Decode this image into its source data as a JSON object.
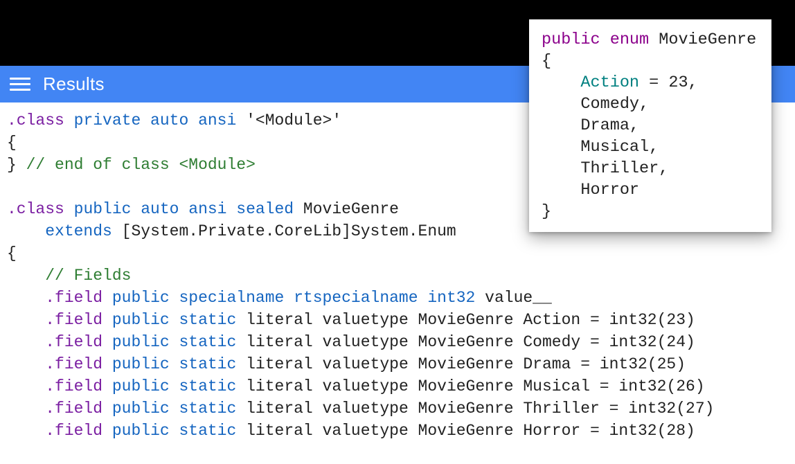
{
  "header": {
    "title": "Results"
  },
  "il": {
    "line1_dir": ".class",
    "line1_mods": "private auto ansi",
    "line1_name": "'<Module>'",
    "line2": "{",
    "line3_brace": "}",
    "line3_comment": "// end of class <Module>",
    "line5_dir": ".class",
    "line5_mods": "public auto ansi sealed",
    "line5_name": "MovieGenre",
    "line6_extends": "extends",
    "line6_target": "[System.Private.CoreLib]System.Enum",
    "line7": "{",
    "fields_comment": "// Fields",
    "f0_dir": ".field",
    "f0_mods": "public specialname rtspecialname",
    "f0_type": "int32",
    "f0_name": "value__",
    "f1_dir": ".field",
    "f1_mods": "public static",
    "f1_rest": "literal valuetype MovieGenre Action = int32(23)",
    "f2_dir": ".field",
    "f2_mods": "public static",
    "f2_rest": "literal valuetype MovieGenre Comedy = int32(24)",
    "f3_dir": ".field",
    "f3_mods": "public static",
    "f3_rest": "literal valuetype MovieGenre Drama = int32(25)",
    "f4_dir": ".field",
    "f4_mods": "public static",
    "f4_rest": "literal valuetype MovieGenre Musical = int32(26)",
    "f5_dir": ".field",
    "f5_mods": "public static",
    "f5_rest": "literal valuetype MovieGenre Thriller = int32(27)",
    "f6_dir": ".field",
    "f6_mods": "public static",
    "f6_rest": "literal valuetype MovieGenre Horror = int32(28)"
  },
  "cs": {
    "l1_kw": "public enum",
    "l1_name": " MovieGenre",
    "l2": "{",
    "l3_id": "Action",
    "l3_rest": " = 23,",
    "l4": "Comedy,",
    "l5": "Drama,",
    "l6": "Musical,",
    "l7": "Thriller,",
    "l8": "Horror",
    "l9": "}",
    "indent": "    "
  }
}
